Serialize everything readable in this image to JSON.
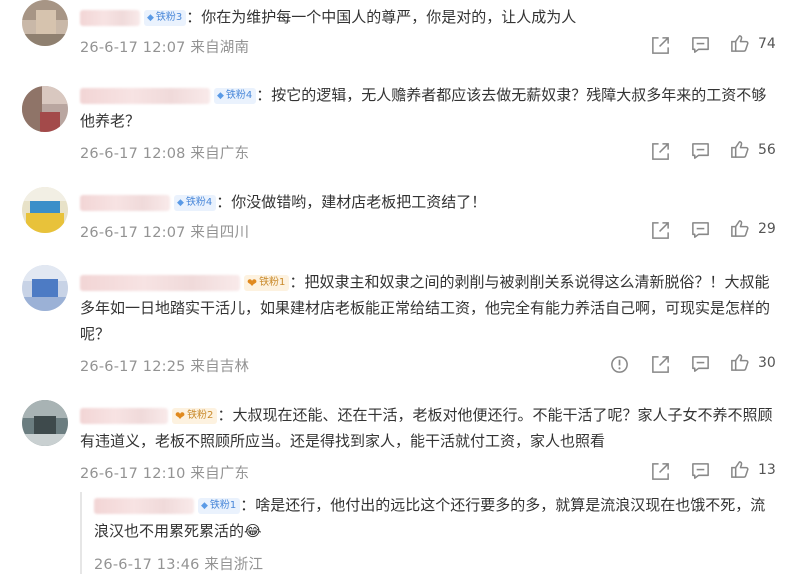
{
  "comments": [
    {
      "badge": "铁粉3",
      "text": "：你在为维护每一个中国人的尊严，你是对的，让人成为人",
      "meta": "26-6-17 12:07 来自湖南",
      "likes": "74"
    },
    {
      "badge": "铁粉4",
      "text": "：按它的逻辑，无人赡养者都应该去做无薪奴隶？残障大叔多年来的工资不够他养老？",
      "meta": "26-6-17 12:08 来自广东",
      "likes": "56"
    },
    {
      "badge": "铁粉4",
      "text": "：你没做错哟，建材店老板把工资结了！",
      "meta": "26-6-17 12:07 来自四川",
      "likes": "29"
    },
    {
      "badge": "铁粉1",
      "text": "：把奴隶主和奴隶之间的剥削与被剥削关系说得这么清新脱俗？！大叔能多年如一日地踏实干活儿，如果建材店老板能正常给结工资，他完全有能力养活自己啊，可现实是怎样的呢？",
      "meta": "26-6-17 12:25 来自吉林",
      "likes": "30"
    },
    {
      "badge": "铁粉2",
      "text": "：大叔现在还能、还在干活，老板对他便还行。不能干活了呢？家人子女不养不照顾有违道义，老板不照顾所应当。还是得找到家人，能干活就付工资，家人也照看",
      "meta": "26-6-17 12:10 来自广东",
      "likes": "13"
    }
  ],
  "reply": {
    "badge": "铁粉1",
    "text": "：啥是还行，他付出的远比这个还行要多的多，就算是流浪汉现在也饿不死，流浪汉也不用累死累活的",
    "emoji": "😂",
    "meta": "26-6-17 13:46 来自浙江"
  },
  "icons": {
    "share": "share-icon",
    "comment": "comment-icon",
    "like": "thumbs-up-icon",
    "report": "report-icon"
  },
  "colors": {
    "text": "#333333",
    "meta": "#939393",
    "badge_blue": "#4a88d9",
    "badge_gold": "#c98a2b"
  }
}
